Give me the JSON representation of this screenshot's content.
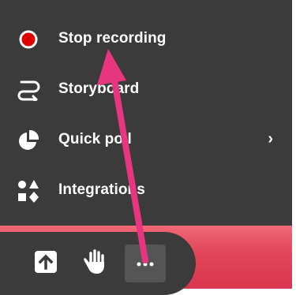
{
  "menu": {
    "items": [
      {
        "label": "Stop recording",
        "icon": "record-icon",
        "has_submenu": false
      },
      {
        "label": "Storyboard",
        "icon": "storyboard-icon",
        "has_submenu": false
      },
      {
        "label": "Quick poll",
        "icon": "pie-chart-icon",
        "has_submenu": true,
        "chevron": "›"
      },
      {
        "label": "Integrations",
        "icon": "integrations-icon",
        "has_submenu": false
      }
    ]
  },
  "toolbar": {
    "buttons": [
      {
        "name": "upload",
        "icon": "upload-icon"
      },
      {
        "name": "raise-hand",
        "icon": "hand-icon"
      },
      {
        "name": "more",
        "icon": "more-icon",
        "selected": true
      }
    ]
  },
  "colors": {
    "panel": "#3b3b3b",
    "record_red": "#e00000",
    "accent_band": "#e2465a",
    "annotation_arrow": "#e8357f"
  }
}
